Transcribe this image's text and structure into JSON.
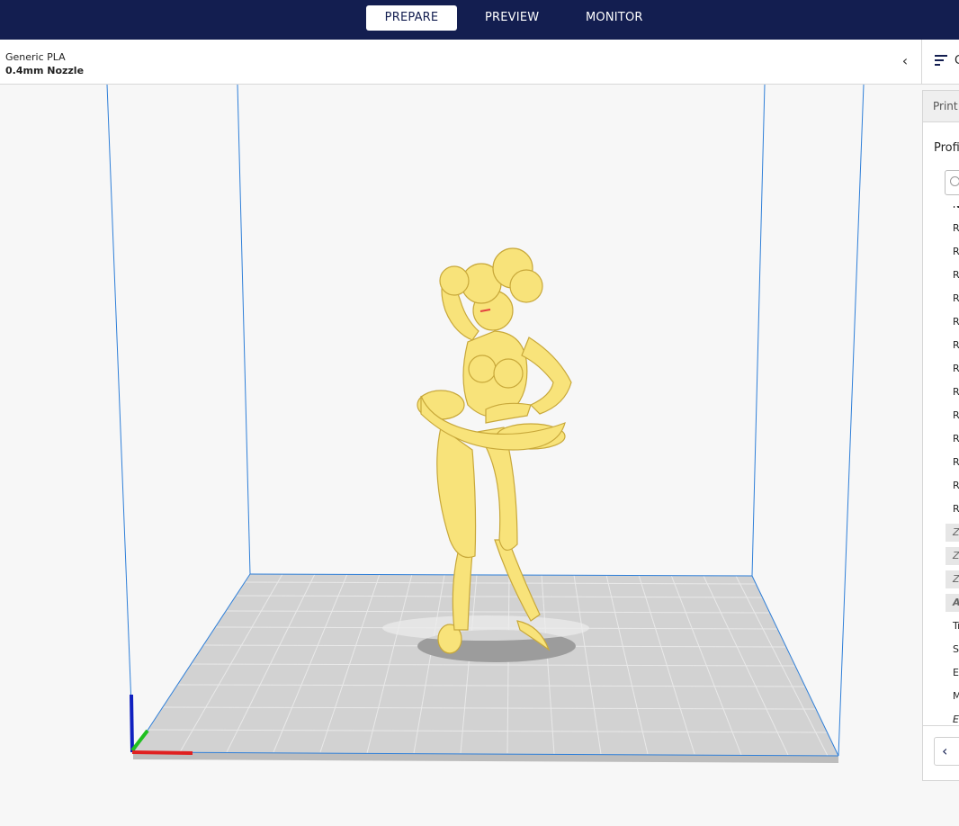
{
  "header": {
    "tabs": [
      {
        "label": "PREPARE",
        "active": true
      },
      {
        "label": "PREVIEW",
        "active": false
      },
      {
        "label": "MONITOR",
        "active": false
      }
    ]
  },
  "material": {
    "name": "Generic PLA",
    "nozzle": "0.4mm Nozzle",
    "collapse_icon": "chevron-left-icon"
  },
  "settings_tab": {
    "icon": "print-settings-icon",
    "label": "C"
  },
  "panel": {
    "header_label": "Print",
    "profile_label": "Profi",
    "search_icon": "search-icon",
    "rows": [
      {
        "label": "N",
        "style": "normal"
      },
      {
        "label": "R",
        "style": "normal"
      },
      {
        "label": "R",
        "style": "normal"
      },
      {
        "label": "R",
        "style": "normal"
      },
      {
        "label": "R",
        "style": "normal"
      },
      {
        "label": "R",
        "style": "normal"
      },
      {
        "label": "R",
        "style": "normal"
      },
      {
        "label": "R",
        "style": "normal"
      },
      {
        "label": "R",
        "style": "normal"
      },
      {
        "label": "R",
        "style": "normal"
      },
      {
        "label": "R",
        "style": "normal"
      },
      {
        "label": "R",
        "style": "normal"
      },
      {
        "label": "R",
        "style": "normal"
      },
      {
        "label": "R",
        "style": "normal"
      },
      {
        "label": "Z",
        "style": "boxed"
      },
      {
        "label": "Z",
        "style": "boxed"
      },
      {
        "label": "Z",
        "style": "boxed"
      },
      {
        "label": "A",
        "style": "bold"
      },
      {
        "label": "Tr",
        "style": "normal"
      },
      {
        "label": "S",
        "style": "normal"
      },
      {
        "label": "E",
        "style": "normal"
      },
      {
        "label": "M",
        "style": "normal"
      },
      {
        "label": "E",
        "style": "italic"
      }
    ],
    "back_icon": "chevron-left-icon"
  },
  "colors": {
    "topbar": "#131e50",
    "model": "#f8e37a",
    "build_volume_edge": "#2f7fd8",
    "axis_x": "#e02020",
    "axis_y": "#20c020",
    "axis_z": "#1020c0"
  }
}
